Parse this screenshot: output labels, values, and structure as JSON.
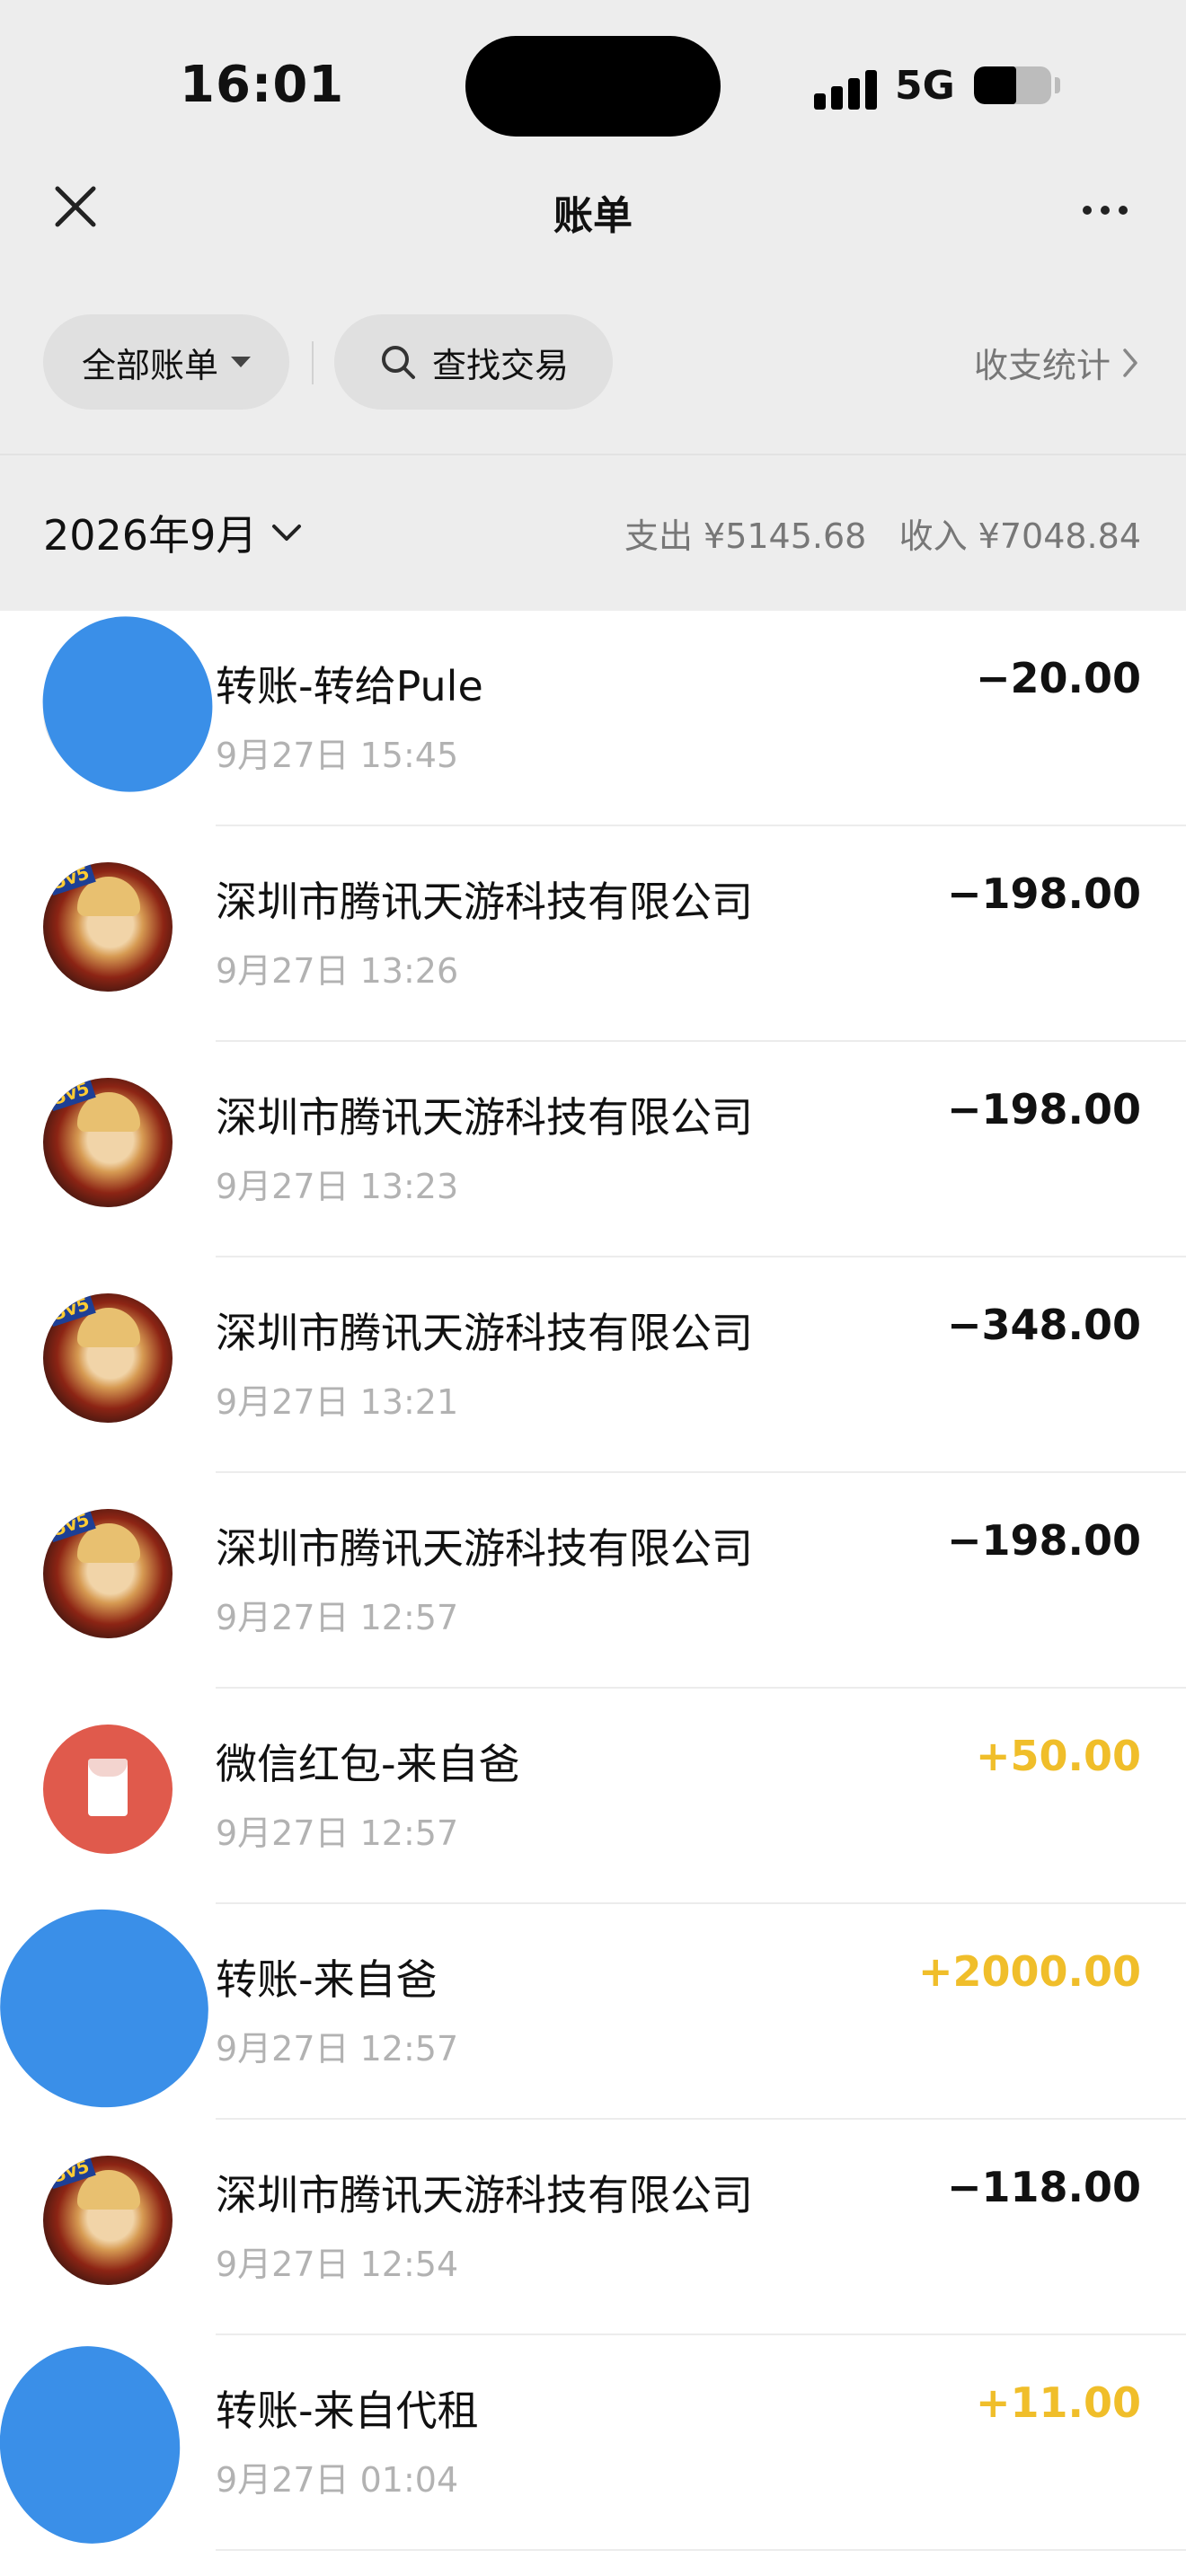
{
  "status_bar": {
    "time": "16:01",
    "network": "5G",
    "battery_level": 0.55
  },
  "nav": {
    "title": "账单",
    "close_icon": "close-icon",
    "more_icon": "more-icon"
  },
  "filters": {
    "all_bills": "全部账单",
    "search": "查找交易",
    "stats": "收支统计"
  },
  "summary": {
    "month": "2026年9月",
    "expense": "支出 ¥5145.68",
    "income": "收入 ¥7048.84"
  },
  "colors": {
    "income": "#f0be2a",
    "expense": "#111111",
    "red_packet": "#e05a4c",
    "redaction": "#3a8fe8"
  },
  "transactions": [
    {
      "title": "转账-转给Pule",
      "time": "9月27日 15:45",
      "amount": "−20.00",
      "type": "out",
      "avatar": "redacted"
    },
    {
      "title": "深圳市腾讯天游科技有限公司",
      "time": "9月27日 13:26",
      "amount": "−198.00",
      "type": "out",
      "avatar": "game"
    },
    {
      "title": "深圳市腾讯天游科技有限公司",
      "time": "9月27日 13:23",
      "amount": "−198.00",
      "type": "out",
      "avatar": "game"
    },
    {
      "title": "深圳市腾讯天游科技有限公司",
      "time": "9月27日 13:21",
      "amount": "−348.00",
      "type": "out",
      "avatar": "game"
    },
    {
      "title": "深圳市腾讯天游科技有限公司",
      "time": "9月27日 12:57",
      "amount": "−198.00",
      "type": "out",
      "avatar": "game"
    },
    {
      "title": "微信红包-来自爸",
      "time": "9月27日 12:57",
      "amount": "+50.00",
      "type": "in",
      "avatar": "red-packet"
    },
    {
      "title": "转账-来自爸",
      "time": "9月27日 12:57",
      "amount": "+2000.00",
      "type": "in",
      "avatar": "redacted"
    },
    {
      "title": "深圳市腾讯天游科技有限公司",
      "time": "9月27日 12:54",
      "amount": "−118.00",
      "type": "out",
      "avatar": "game"
    },
    {
      "title": "转账-来自代租",
      "time": "9月27日 01:04",
      "amount": "+11.00",
      "type": "in",
      "avatar": "redacted"
    }
  ]
}
